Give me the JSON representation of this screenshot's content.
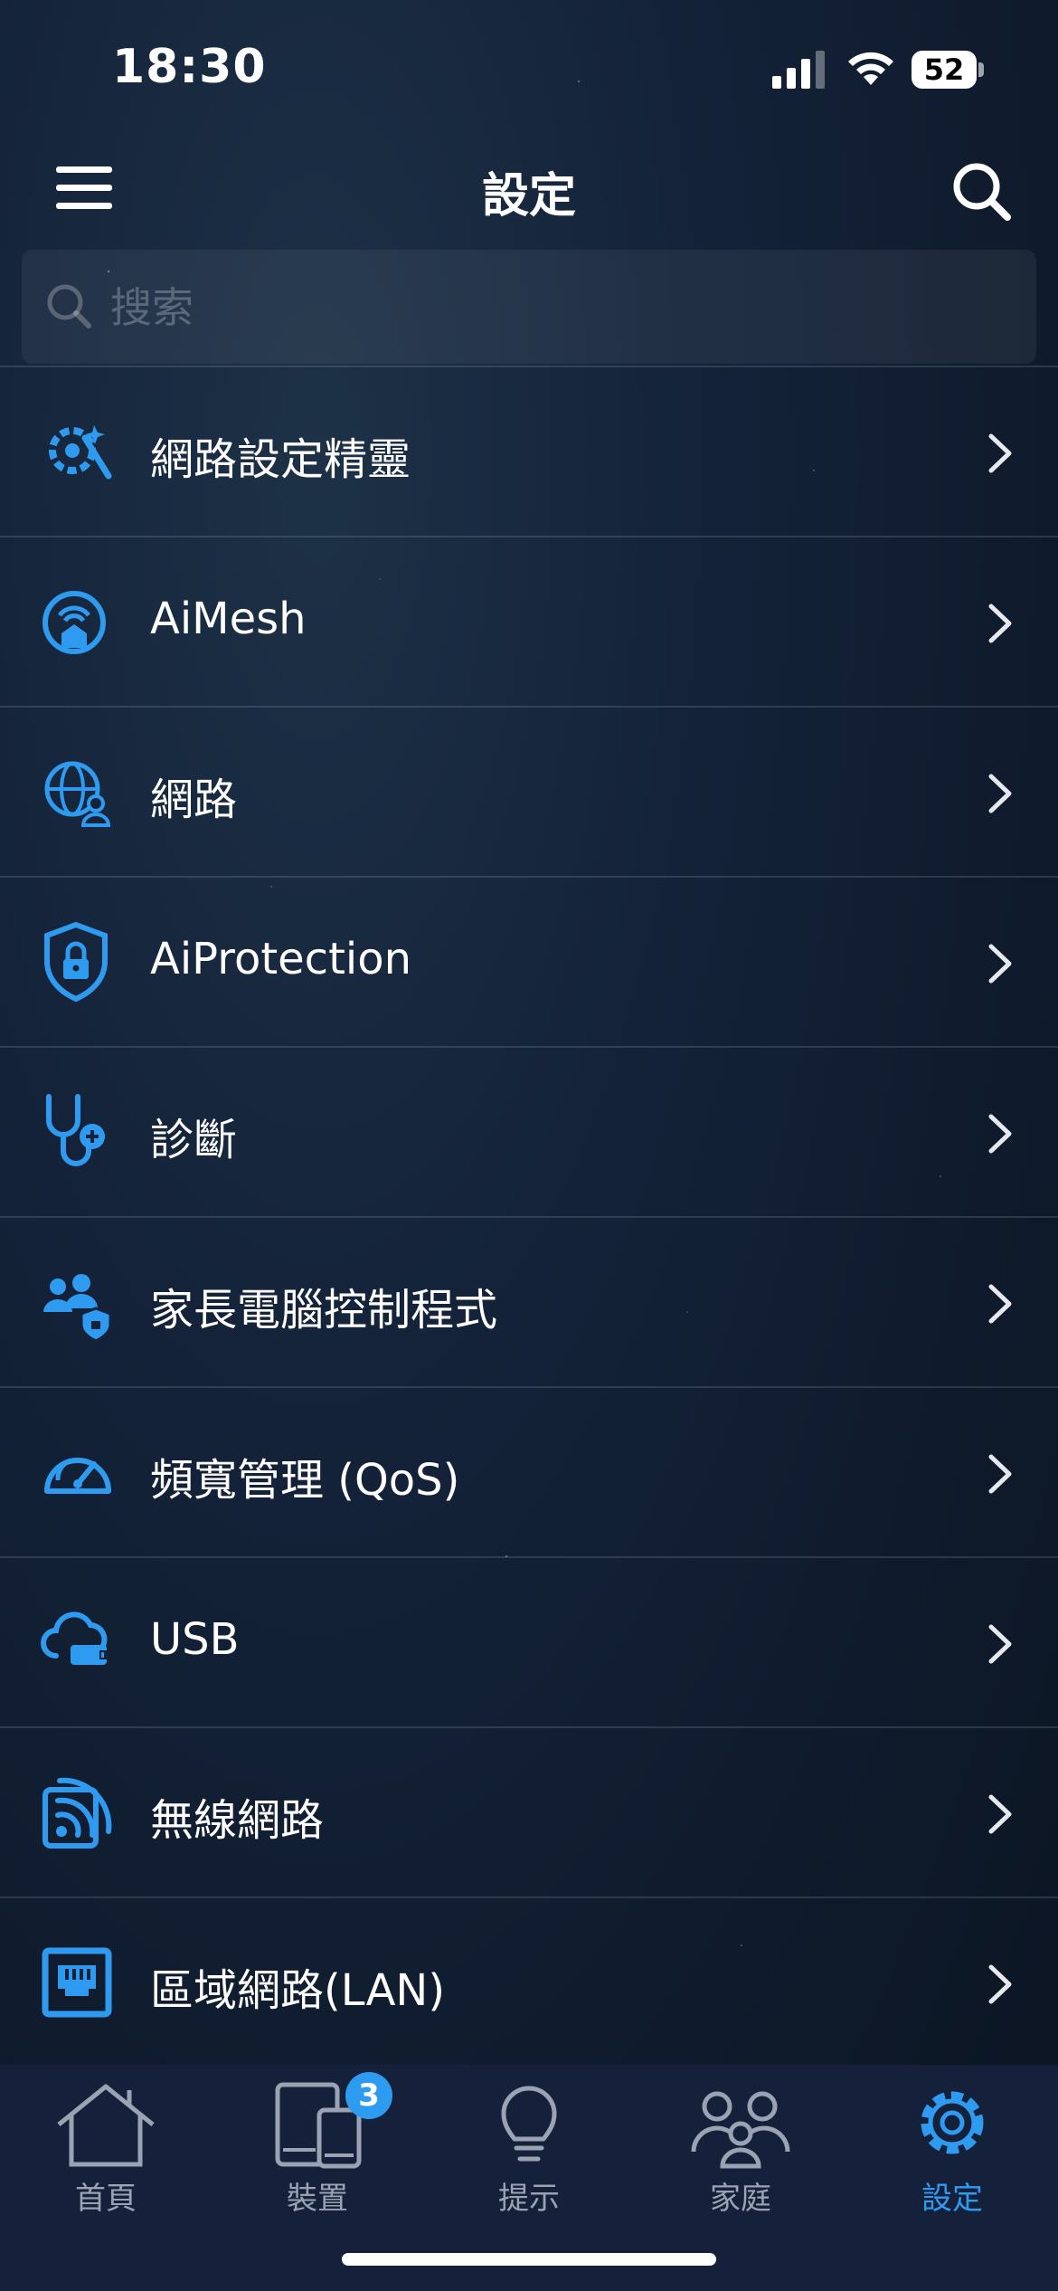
{
  "status_bar": {
    "time": "18:30",
    "battery": "52"
  },
  "header": {
    "title": "設定"
  },
  "search": {
    "placeholder": "搜索"
  },
  "settings_items": [
    {
      "label": "網路設定精靈",
      "icon": "wizard-gear-icon"
    },
    {
      "label": "AiMesh",
      "icon": "aimesh-icon"
    },
    {
      "label": "網路",
      "icon": "globe-user-icon"
    },
    {
      "label": "AiProtection",
      "icon": "shield-lock-icon"
    },
    {
      "label": "診斷",
      "icon": "stethoscope-icon"
    },
    {
      "label": "家長電腦控制程式",
      "icon": "parental-control-icon"
    },
    {
      "label": "頻寬管理 (QoS)",
      "icon": "speedometer-icon"
    },
    {
      "label": "USB",
      "icon": "cloud-usb-icon"
    },
    {
      "label": "無線網路",
      "icon": "wireless-icon"
    },
    {
      "label": "區域網路(LAN)",
      "icon": "lan-port-icon"
    }
  ],
  "tabs": [
    {
      "label": "首頁",
      "icon": "home-icon"
    },
    {
      "label": "裝置",
      "icon": "devices-icon",
      "badge": "3"
    },
    {
      "label": "提示",
      "icon": "lightbulb-icon"
    },
    {
      "label": "家庭",
      "icon": "family-icon"
    },
    {
      "label": "設定",
      "icon": "gear-icon",
      "active": true
    }
  ],
  "colors": {
    "accent": "#2f9bf0",
    "inactive": "#9aa3b3"
  }
}
